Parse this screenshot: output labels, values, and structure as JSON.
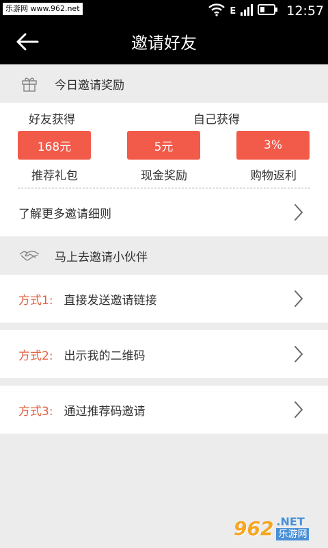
{
  "status_bar": {
    "watermark": "乐游网 www.962.net",
    "signal_label": "E",
    "time": "12:57"
  },
  "header": {
    "title": "邀请好友"
  },
  "reward_section": {
    "title": "今日邀请奖励",
    "friend_gets": "好友获得",
    "self_gets": "自己获得",
    "items": [
      {
        "value": "168元",
        "label": "推荐礼包"
      },
      {
        "value": "5元",
        "label": "现金奖励"
      },
      {
        "value": "3%",
        "label": "购物返利"
      }
    ]
  },
  "rules_link": {
    "label": "了解更多邀请细则"
  },
  "invite_section": {
    "title": "马上去邀请小伙伴",
    "methods": [
      {
        "prefix": "方式1:",
        "text": "直接发送邀请链接"
      },
      {
        "prefix": "方式2:",
        "text": "出示我的二维码"
      },
      {
        "prefix": "方式3:",
        "text": "通过推荐码邀请"
      }
    ]
  },
  "watermark_bottom": {
    "logo": "962",
    "net": ".NET",
    "name": "乐游网"
  },
  "colors": {
    "accent": "#f25a4a",
    "method_prefix": "#e2603f",
    "bar_background": "#000000",
    "page_background": "#ececec"
  }
}
